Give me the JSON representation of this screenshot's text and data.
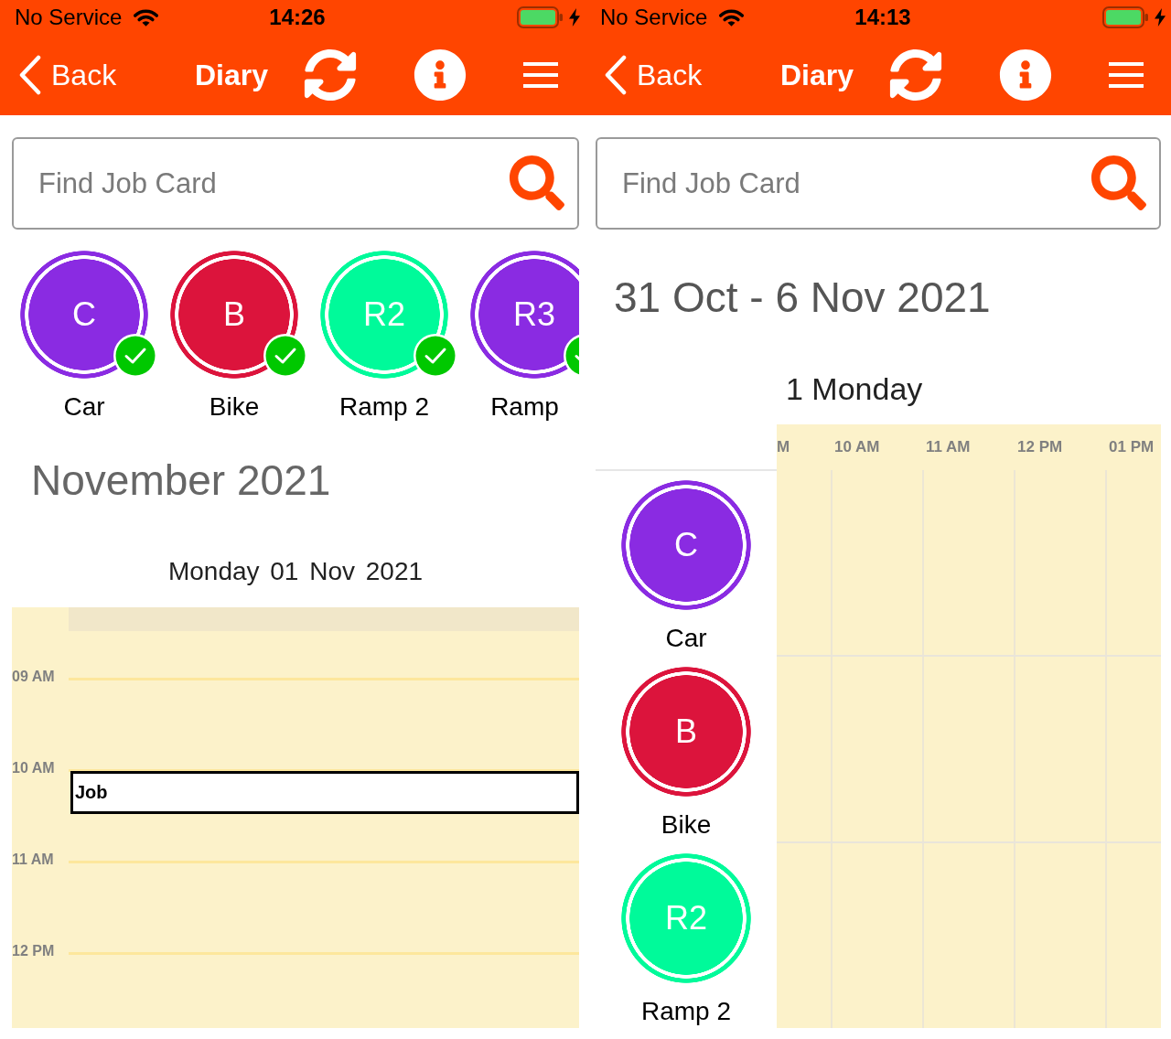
{
  "screens": [
    {
      "kind": "day",
      "status_bar": {
        "carrier": "No Service",
        "time": "14:26"
      },
      "nav_bar": {
        "back": "Back",
        "title": "Diary"
      },
      "search": {
        "placeholder": "Find Job Card"
      },
      "resources": [
        {
          "initials": "C",
          "name": "Car",
          "color": "#8a2be2",
          "checked": true
        },
        {
          "initials": "B",
          "name": "Bike",
          "color": "#dc143c",
          "checked": true
        },
        {
          "initials": "R2",
          "name": "Ramp 2",
          "color": "#00fa9a",
          "checked": true
        },
        {
          "initials": "R3",
          "name": "Ramp",
          "color": "#8a2be2",
          "checked": true
        }
      ],
      "month_title": "November 2021",
      "day_title": "Monday 01 Nov 2021",
      "hours": [
        {
          "label": "09 AM"
        },
        {
          "label": "10 AM",
          "events": [
            {
              "title": "Job"
            }
          ]
        },
        {
          "label": "11 AM"
        },
        {
          "label": "12 PM"
        }
      ]
    },
    {
      "kind": "week",
      "status_bar": {
        "carrier": "No Service",
        "time": "14:13"
      },
      "nav_bar": {
        "back": "Back",
        "title": "Diary"
      },
      "search": {
        "placeholder": "Find Job Card"
      },
      "range_title": "31 Oct - 6 Nov 2021",
      "day_title": "1 Monday",
      "time_columns": [
        "M",
        "10 AM",
        "11 AM",
        "12 PM",
        "01 PM"
      ],
      "resources": [
        {
          "initials": "C",
          "name": "Car",
          "color": "#8a2be2"
        },
        {
          "initials": "B",
          "name": "Bike",
          "color": "#dc143c"
        },
        {
          "initials": "R2",
          "name": "Ramp 2",
          "color": "#00fa9a"
        }
      ]
    }
  ]
}
